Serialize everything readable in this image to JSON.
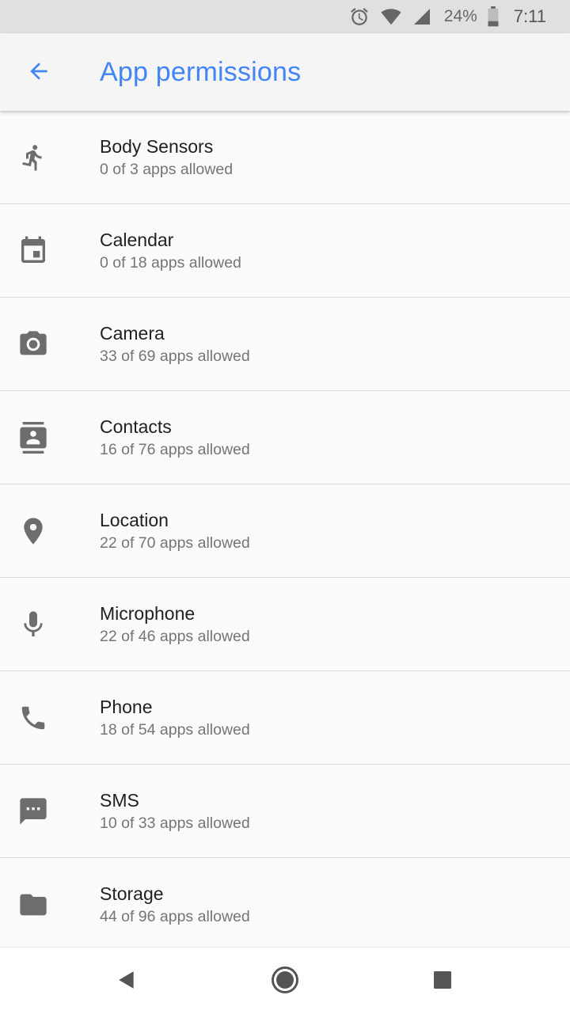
{
  "status_bar": {
    "battery_percent": "24%",
    "time": "7:11",
    "icons": [
      "alarm-icon",
      "wifi-icon",
      "cell-signal-icon",
      "battery-icon"
    ]
  },
  "app_bar": {
    "title": "App permissions",
    "back_icon": "arrow-back-icon",
    "accent_color": "#4285f4"
  },
  "permissions": [
    {
      "label": "Body Sensors",
      "summary": "0 of 3 apps allowed",
      "icon": "run-icon"
    },
    {
      "label": "Calendar",
      "summary": "0 of 18 apps allowed",
      "icon": "calendar-icon"
    },
    {
      "label": "Camera",
      "summary": "33 of 69 apps allowed",
      "icon": "camera-icon"
    },
    {
      "label": "Contacts",
      "summary": "16 of 76 apps allowed",
      "icon": "contacts-icon"
    },
    {
      "label": "Location",
      "summary": "22 of 70 apps allowed",
      "icon": "location-icon"
    },
    {
      "label": "Microphone",
      "summary": "22 of 46 apps allowed",
      "icon": "microphone-icon"
    },
    {
      "label": "Phone",
      "summary": "18 of 54 apps allowed",
      "icon": "phone-icon"
    },
    {
      "label": "SMS",
      "summary": "10 of 33 apps allowed",
      "icon": "sms-icon"
    },
    {
      "label": "Storage",
      "summary": "44 of 96 apps allowed",
      "icon": "folder-icon"
    }
  ],
  "nav_bar": {
    "icons": [
      "nav-back-icon",
      "nav-home-icon",
      "nav-recents-icon"
    ]
  }
}
